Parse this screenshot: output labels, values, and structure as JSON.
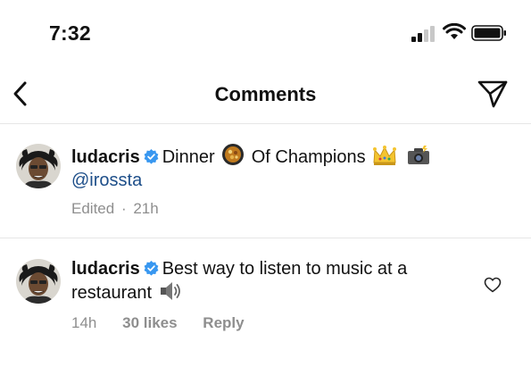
{
  "status_bar": {
    "time": "7:32"
  },
  "nav": {
    "title": "Comments"
  },
  "comments": [
    {
      "username": "ludacris",
      "text_1": "Dinner",
      "text_2": "Of Champions",
      "mention": "@irossta",
      "edited": "Edited",
      "separator": "·",
      "age": "21h",
      "emoji_icons": [
        "pan-food-emoji",
        "crown-emoji",
        "camera-flash-emoji"
      ]
    },
    {
      "username": "ludacris",
      "text_1": "Best way to listen to music at a",
      "text_2": "restaurant",
      "age": "14h",
      "likes": "30 likes",
      "reply": "Reply",
      "emoji_icons": [
        "speaker-emoji"
      ]
    }
  ],
  "colors": {
    "verified": "#3897f0",
    "mention": "#1d4e89",
    "meta": "#8e8e8e",
    "divider": "#e6e6e6"
  }
}
